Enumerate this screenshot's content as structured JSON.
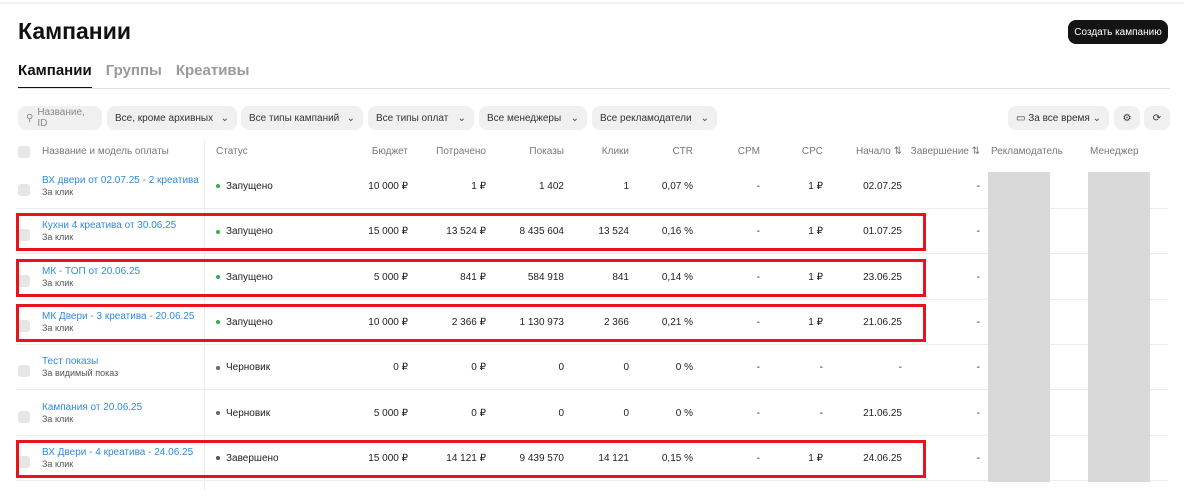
{
  "title": "Кампании",
  "create_label": "Создать кампанию",
  "tabs": [
    "Кампании",
    "Группы",
    "Креативы"
  ],
  "filters": {
    "search_placeholder": "Название, ID",
    "status": "Все, кроме архивных",
    "campaign_types": "Все типы кампаний",
    "payment_types": "Все типы оплат",
    "managers": "Все менеджеры",
    "advertisers": "Все рекламодатели",
    "period": "За все время"
  },
  "columns": [
    "Название и модель оплаты",
    "Статус",
    "Бюджет",
    "Потрачено",
    "Показы",
    "Клики",
    "CTR",
    "CPM",
    "CPC",
    "Начало ⇅",
    "Завершение ⇅",
    "Рекламодатель",
    "Менеджер"
  ],
  "status_colors": {
    "Запущено": "#2bb24c",
    "Черновик": "#666666",
    "Завершено": "#555555"
  },
  "rows": [
    {
      "name": "ВХ двери от 02.07.25 - 2 креатива",
      "model": "За клик",
      "status": "Запущено",
      "budget": "10 000 ₽",
      "spent": "1 ₽",
      "shows": "1 402",
      "clicks": "1",
      "ctr": "0,07 %",
      "cpm": "-",
      "cpc": "1 ₽",
      "start": "02.07.25",
      "end": "-",
      "highlighted": false
    },
    {
      "name": "Кухни 4 креатива от 30.06.25",
      "model": "За клик",
      "status": "Запущено",
      "budget": "15 000 ₽",
      "spent": "13 524 ₽",
      "shows": "8 435 604",
      "clicks": "13 524",
      "ctr": "0,16 %",
      "cpm": "-",
      "cpc": "1 ₽",
      "start": "01.07.25",
      "end": "-",
      "highlighted": true
    },
    {
      "name": "МК - ТОП от 20.06.25",
      "model": "За клик",
      "status": "Запущено",
      "budget": "5 000 ₽",
      "spent": "841 ₽",
      "shows": "584 918",
      "clicks": "841",
      "ctr": "0,14 %",
      "cpm": "-",
      "cpc": "1 ₽",
      "start": "23.06.25",
      "end": "-",
      "highlighted": true
    },
    {
      "name": "МК Двери - 3 креатива - 20.06.25",
      "model": "За клик",
      "status": "Запущено",
      "budget": "10 000 ₽",
      "spent": "2 366 ₽",
      "shows": "1 130 973",
      "clicks": "2 366",
      "ctr": "0,21 %",
      "cpm": "-",
      "cpc": "1 ₽",
      "start": "21.06.25",
      "end": "-",
      "highlighted": true
    },
    {
      "name": "Тест показы",
      "model": "За видимый показ",
      "status": "Черновик",
      "budget": "0 ₽",
      "spent": "0 ₽",
      "shows": "0",
      "clicks": "0",
      "ctr": "0 %",
      "cpm": "-",
      "cpc": "-",
      "start": "-",
      "end": "-",
      "highlighted": false
    },
    {
      "name": "Кампания от 20.06.25",
      "model": "За клик",
      "status": "Черновик",
      "budget": "5 000 ₽",
      "spent": "0 ₽",
      "shows": "0",
      "clicks": "0",
      "ctr": "0 %",
      "cpm": "-",
      "cpc": "-",
      "start": "21.06.25",
      "end": "-",
      "highlighted": false
    },
    {
      "name": "ВХ Двери - 4 креатива - 24.06.25",
      "model": "За клик",
      "status": "Завершено",
      "budget": "15 000 ₽",
      "spent": "14 121 ₽",
      "shows": "9 439 570",
      "clicks": "14 121",
      "ctr": "0,15 %",
      "cpm": "-",
      "cpc": "1 ₽",
      "start": "24.06.25",
      "end": "-",
      "highlighted": true
    }
  ]
}
